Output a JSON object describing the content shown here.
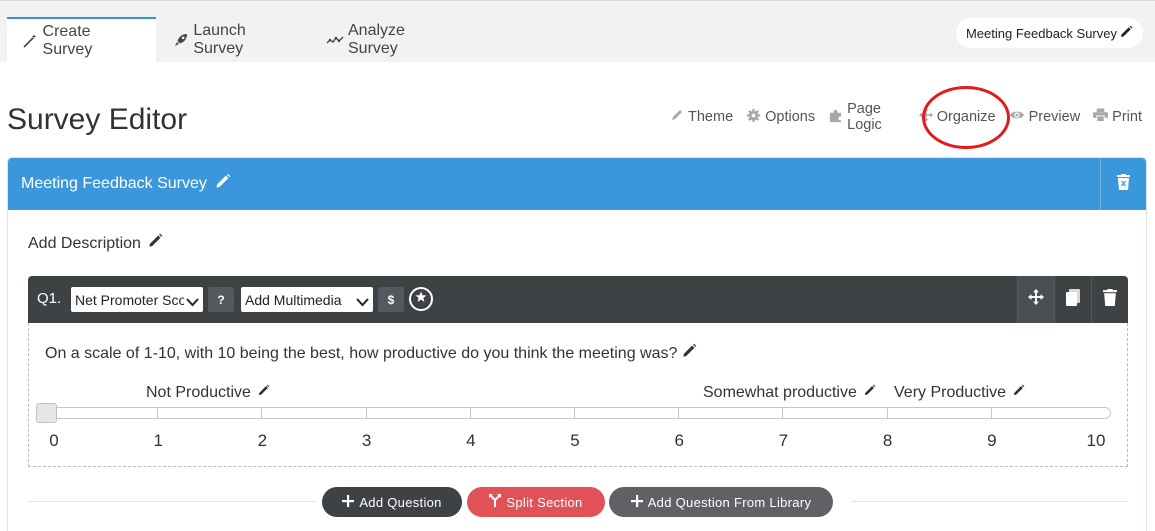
{
  "tabs": [
    {
      "label": "Create Survey",
      "icon": "magic-wand-icon",
      "active": true
    },
    {
      "label": "Launch Survey",
      "icon": "rocket-icon",
      "active": false
    },
    {
      "label": "Analyze Survey",
      "icon": "line-chart-icon",
      "active": false
    }
  ],
  "survey_name_chip": "Meeting Feedback Survey",
  "page_title": "Survey Editor",
  "toolbar": {
    "theme": "Theme",
    "options": "Options",
    "page_logic": "Page Logic",
    "organize": "Organize",
    "preview": "Preview",
    "print": "Print"
  },
  "section": {
    "title": "Meeting Feedback Survey",
    "add_description": "Add Description"
  },
  "question": {
    "number": "Q1.",
    "type_select": "Net Promoter Score",
    "help_label": "?",
    "multimedia_select": "Add Multimedia",
    "dollar_label": "$",
    "text": "On a scale of 1-10, with 10 being the best, how productive do you think the meeting was?",
    "scale_labels": {
      "low": "Not Productive",
      "mid": "Somewhat productive",
      "high": "Very Productive"
    },
    "scale_values": [
      "0",
      "1",
      "2",
      "3",
      "4",
      "5",
      "6",
      "7",
      "8",
      "9",
      "10"
    ],
    "slider_value": 0
  },
  "buttons": {
    "add_question": "Add Question",
    "split_section": "Split Section",
    "add_from_library": "Add Question From Library"
  },
  "colors": {
    "accent": "#3b97dc",
    "question_bar": "#3f4245",
    "add_question_btn": "#3f4245",
    "split_section_btn": "#e05258",
    "library_btn": "#5f6165",
    "highlight_ellipse": "#e11a1a"
  }
}
